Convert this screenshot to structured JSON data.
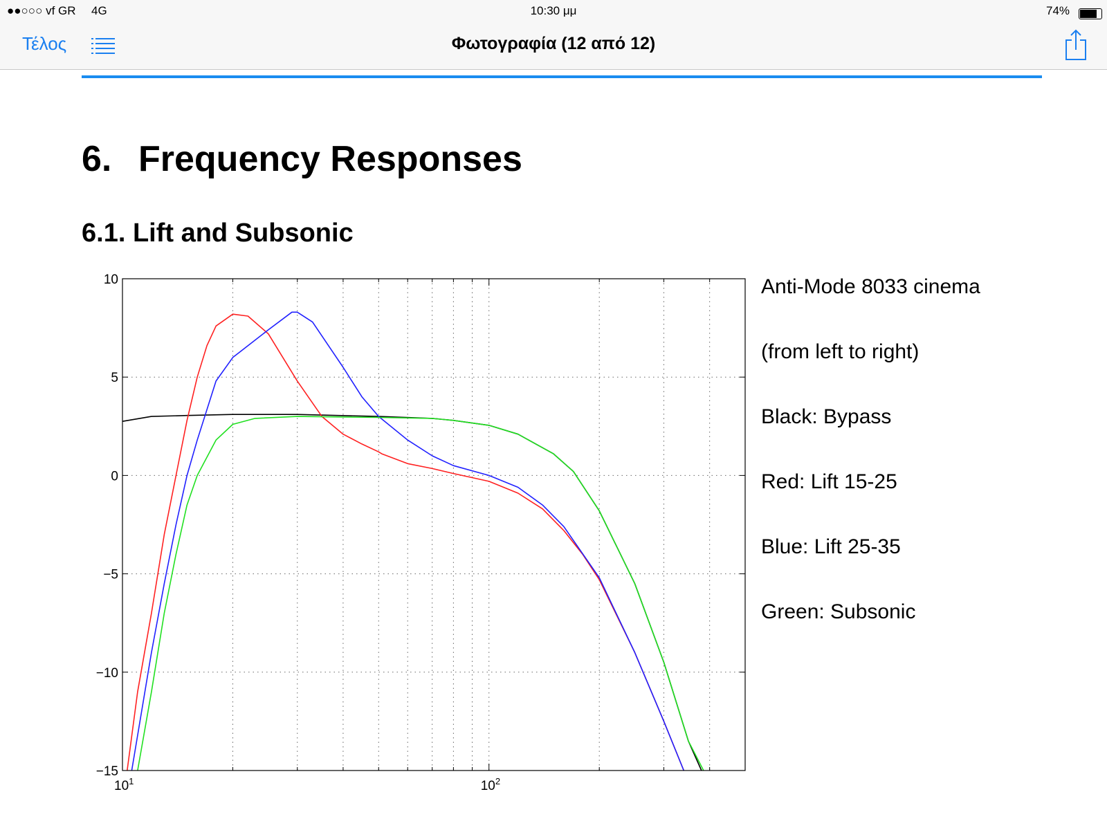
{
  "status_bar": {
    "carrier": "●●○○○ vf GR",
    "network": "4G",
    "time": "10:30 μμ",
    "battery": "74%",
    "battery_level": 0.74
  },
  "nav_bar": {
    "done_label": "Τέλος",
    "title": "Φωτογραφία (12 από 12)"
  },
  "reading_progress": 1.0,
  "document": {
    "section_number": "6.",
    "section_title": "Frequency Responses",
    "subsection_title": "6.1. Lift and Subsonic",
    "legend_lines": [
      "Anti-Mode 8033 cinema",
      "(from left to right)",
      "Black:  Bypass",
      "Red: Lift 15-25",
      "Blue: Lift 25-35",
      "Green: Subsonic"
    ]
  },
  "chart_data": {
    "type": "line",
    "title": "",
    "xlabel": "",
    "ylabel": "",
    "xscale": "log",
    "xlim": [
      10,
      500
    ],
    "ylim": [
      -15,
      10
    ],
    "yticks": [
      10,
      5,
      0,
      -5,
      -10,
      -15
    ],
    "ytick_labels": [
      "10",
      "5",
      "0",
      "−5",
      "−10",
      "−15"
    ],
    "xticks": [
      {
        "base": "10",
        "exp": "1",
        "value": 10
      },
      {
        "base": "10",
        "exp": "2",
        "value": 100
      }
    ],
    "grid": true,
    "series": [
      {
        "name": "Bypass",
        "color": "#000000",
        "points": [
          [
            10,
            2.75
          ],
          [
            12,
            3.0
          ],
          [
            15,
            3.05
          ],
          [
            20,
            3.1
          ],
          [
            30,
            3.1
          ],
          [
            50,
            3.0
          ],
          [
            70,
            2.9
          ],
          [
            80,
            2.8
          ],
          [
            100,
            2.55
          ],
          [
            120,
            2.1
          ],
          [
            150,
            1.1
          ],
          [
            170,
            0.2
          ],
          [
            200,
            -1.8
          ],
          [
            250,
            -5.5
          ],
          [
            300,
            -9.5
          ],
          [
            350,
            -13.5
          ],
          [
            380,
            -15
          ]
        ]
      },
      {
        "name": "Lift 15-25",
        "color": "#ff2020",
        "points": [
          [
            10.3,
            -15
          ],
          [
            11,
            -11
          ],
          [
            12,
            -7
          ],
          [
            13,
            -3
          ],
          [
            14,
            0
          ],
          [
            15,
            2.8
          ],
          [
            16,
            5
          ],
          [
            17,
            6.6
          ],
          [
            18,
            7.6
          ],
          [
            20,
            8.2
          ],
          [
            22,
            8.1
          ],
          [
            25,
            7.2
          ],
          [
            30,
            4.8
          ],
          [
            35,
            3.0
          ],
          [
            40,
            2.1
          ],
          [
            45,
            1.6
          ],
          [
            50,
            1.2
          ],
          [
            51,
            1.1
          ],
          [
            60,
            0.6
          ],
          [
            70,
            0.35
          ],
          [
            80,
            0.1
          ],
          [
            100,
            -0.3
          ],
          [
            120,
            -0.9
          ],
          [
            140,
            -1.7
          ],
          [
            160,
            -2.8
          ],
          [
            180,
            -4
          ],
          [
            200,
            -5.3
          ],
          [
            250,
            -9
          ],
          [
            300,
            -12.5
          ],
          [
            340,
            -15
          ]
        ]
      },
      {
        "name": "Lift 25-35",
        "color": "#2020ff",
        "points": [
          [
            10.6,
            -15
          ],
          [
            12,
            -9
          ],
          [
            13,
            -5.5
          ],
          [
            14,
            -2.5
          ],
          [
            15,
            0
          ],
          [
            16,
            1.8
          ],
          [
            18,
            4.8
          ],
          [
            20,
            6
          ],
          [
            25,
            7.4
          ],
          [
            29,
            8.3
          ],
          [
            30,
            8.3
          ],
          [
            33,
            7.8
          ],
          [
            40,
            5.5
          ],
          [
            45,
            4.0
          ],
          [
            50,
            3.0
          ],
          [
            60,
            1.8
          ],
          [
            70,
            1.0
          ],
          [
            80,
            0.5
          ],
          [
            100,
            0
          ],
          [
            120,
            -0.6
          ],
          [
            140,
            -1.5
          ],
          [
            160,
            -2.6
          ],
          [
            200,
            -5.2
          ],
          [
            250,
            -9
          ],
          [
            300,
            -12.5
          ],
          [
            340,
            -15
          ]
        ]
      },
      {
        "name": "Subsonic",
        "color": "#20e020",
        "points": [
          [
            11,
            -15
          ],
          [
            12,
            -11
          ],
          [
            13,
            -7
          ],
          [
            14,
            -4
          ],
          [
            15,
            -1.5
          ],
          [
            16,
            0
          ],
          [
            18,
            1.8
          ],
          [
            20,
            2.6
          ],
          [
            23,
            2.9
          ],
          [
            30,
            3.0
          ],
          [
            50,
            2.95
          ],
          [
            70,
            2.9
          ],
          [
            80,
            2.8
          ],
          [
            100,
            2.55
          ],
          [
            120,
            2.1
          ],
          [
            150,
            1.1
          ],
          [
            170,
            0.2
          ],
          [
            200,
            -1.8
          ],
          [
            250,
            -5.5
          ],
          [
            300,
            -9.5
          ],
          [
            350,
            -13.5
          ],
          [
            385,
            -15
          ]
        ]
      }
    ]
  }
}
